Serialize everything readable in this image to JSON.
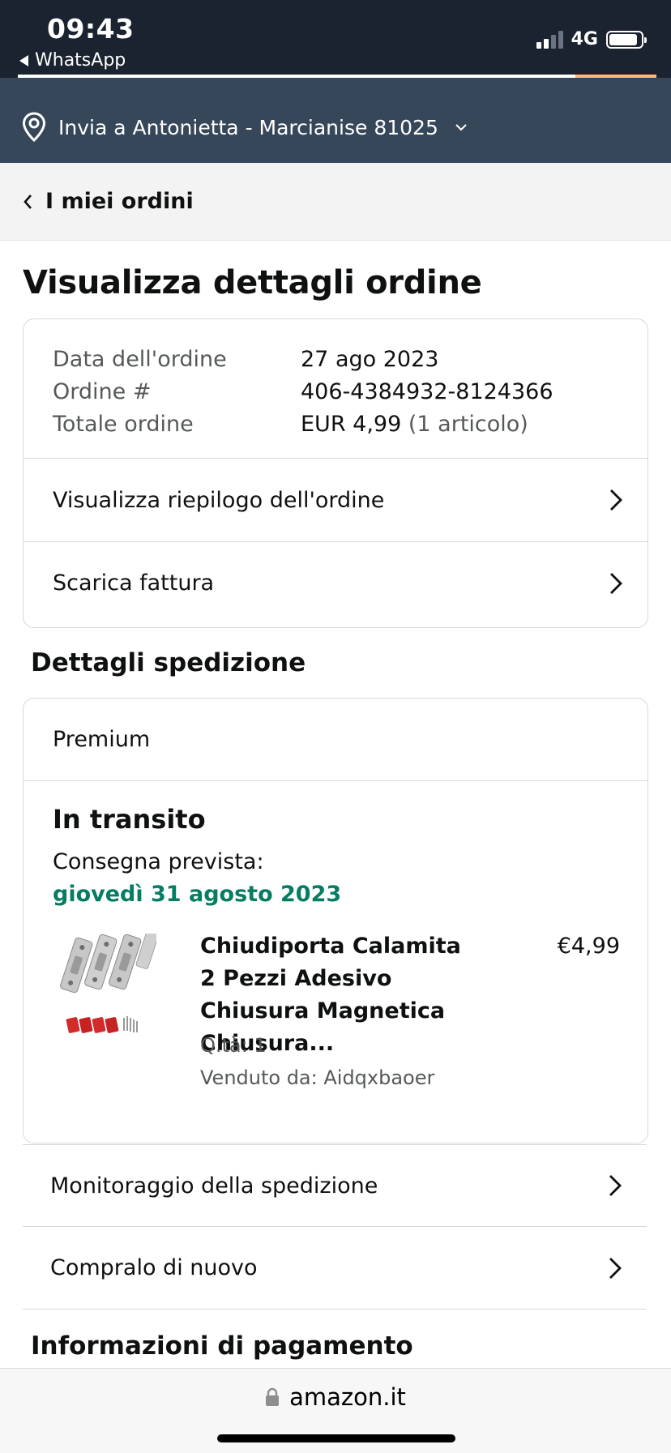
{
  "status_bar": {
    "time": "09:43",
    "back_app": "WhatsApp",
    "network": "4G",
    "signal_bars_active": 2,
    "battery_level": 0.9
  },
  "location": {
    "text": "Invia a Antonietta - Marcianise 81025",
    "icon": "location-pin-icon"
  },
  "breadcrumb": {
    "label": "I miei ordini"
  },
  "page_title": "Visualizza dettagli ordine",
  "order_summary": {
    "date_label": "Data dell'ordine",
    "date_value": "27 ago 2023",
    "number_label": "Ordine #",
    "number_value": "406-4384932-8124366",
    "total_label": "Totale ordine",
    "total_value": "EUR 4,99",
    "total_items": "(1 articolo)",
    "links": [
      {
        "label": "Visualizza riepilogo dell'ordine"
      },
      {
        "label": "Scarica fattura"
      }
    ]
  },
  "shipping": {
    "heading": "Dettagli spedizione",
    "type": "Premium",
    "status": "In transito",
    "eta_label": "Consegna prevista:",
    "eta_date": "giovedì 31 agosto 2023",
    "product": {
      "title": "Chiudiporta Calamita 2 Pezzi Adesivo Chiusura Magnetica Chiusura...",
      "price": "€4,99",
      "qty": "Q.tà: 1",
      "seller": "Venduto da: Aidqxbaoer"
    }
  },
  "actions": [
    {
      "label": "Monitoraggio della spedizione"
    },
    {
      "label": "Compralo di nuovo"
    }
  ],
  "payment": {
    "heading": "Informazioni di pagamento"
  },
  "browser": {
    "url": "amazon.it"
  },
  "colors": {
    "status_bar": "#1c2330",
    "location_bar": "#37475a",
    "eta_green": "#067d62",
    "search_accent": "#febd69"
  }
}
